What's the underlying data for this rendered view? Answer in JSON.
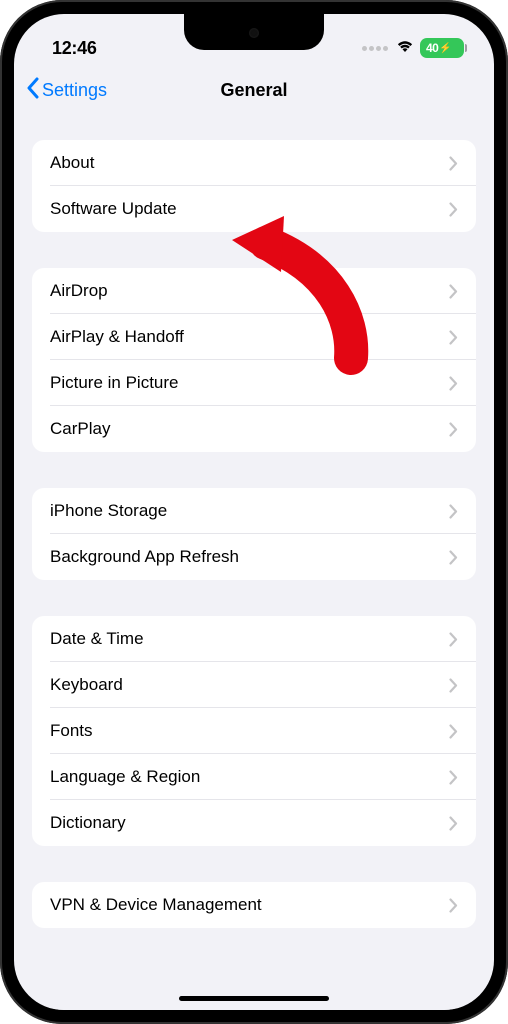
{
  "status": {
    "time": "12:46",
    "battery": "40"
  },
  "nav": {
    "back_label": "Settings",
    "title": "General"
  },
  "sections": [
    {
      "rows": [
        {
          "label": "About",
          "name": "row-about"
        },
        {
          "label": "Software Update",
          "name": "row-software-update"
        }
      ]
    },
    {
      "rows": [
        {
          "label": "AirDrop",
          "name": "row-airdrop"
        },
        {
          "label": "AirPlay & Handoff",
          "name": "row-airplay-handoff"
        },
        {
          "label": "Picture in Picture",
          "name": "row-picture-in-picture"
        },
        {
          "label": "CarPlay",
          "name": "row-carplay"
        }
      ]
    },
    {
      "rows": [
        {
          "label": "iPhone Storage",
          "name": "row-iphone-storage"
        },
        {
          "label": "Background App Refresh",
          "name": "row-background-app-refresh"
        }
      ]
    },
    {
      "rows": [
        {
          "label": "Date & Time",
          "name": "row-date-time"
        },
        {
          "label": "Keyboard",
          "name": "row-keyboard"
        },
        {
          "label": "Fonts",
          "name": "row-fonts"
        },
        {
          "label": "Language & Region",
          "name": "row-language-region"
        },
        {
          "label": "Dictionary",
          "name": "row-dictionary"
        }
      ]
    },
    {
      "rows": [
        {
          "label": "VPN & Device Management",
          "name": "row-vpn-device-management"
        }
      ]
    }
  ]
}
